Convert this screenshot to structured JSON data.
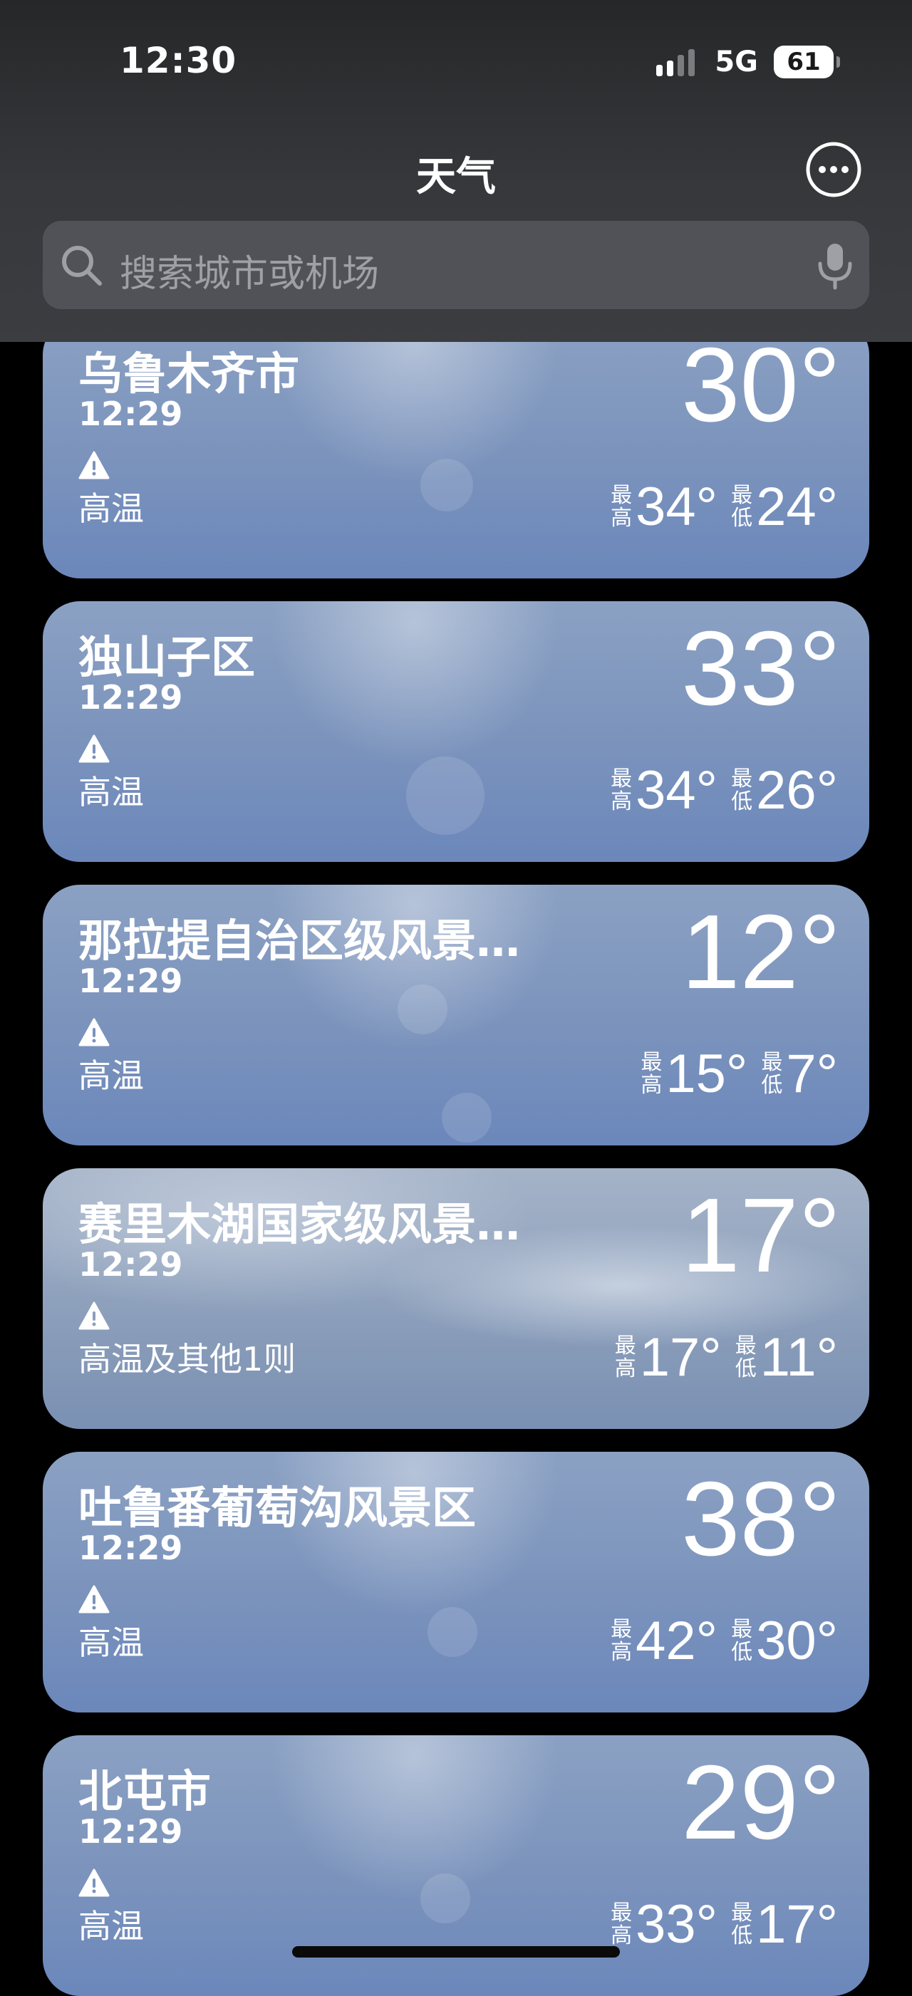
{
  "status_bar": {
    "time": "12:30",
    "network": "5G",
    "battery": "61",
    "signal_bars": 4,
    "signal_active": 2
  },
  "header": {
    "title": "天气",
    "more_icon": "ellipsis-circle-icon"
  },
  "search": {
    "placeholder": "搜索城市或机场",
    "search_icon": "magnifying-glass-icon",
    "mic_icon": "microphone-icon"
  },
  "cities": [
    {
      "name": "乌鲁木齐市",
      "time": "12:29",
      "temp": "30°",
      "alert": "高温",
      "high_label": "最高",
      "high": "34°",
      "low_label": "最低",
      "low": "24°",
      "condition": "clear"
    },
    {
      "name": "独山子区",
      "time": "12:29",
      "temp": "33°",
      "alert": "高温",
      "high_label": "最高",
      "high": "34°",
      "low_label": "最低",
      "low": "26°",
      "condition": "clear"
    },
    {
      "name": "那拉提自治区级风景…",
      "time": "12:29",
      "temp": "12°",
      "alert": "高温",
      "high_label": "最高",
      "high": "15°",
      "low_label": "最低",
      "low": "7°",
      "condition": "clear"
    },
    {
      "name": "赛里木湖国家级风景…",
      "time": "12:29",
      "temp": "17°",
      "alert": "高温及其他1则",
      "high_label": "最高",
      "high": "17°",
      "low_label": "最低",
      "low": "11°",
      "condition": "cloudy"
    },
    {
      "name": "吐鲁番葡萄沟风景区",
      "time": "12:29",
      "temp": "38°",
      "alert": "高温",
      "high_label": "最高",
      "high": "42°",
      "low_label": "最低",
      "low": "30°",
      "condition": "clear"
    },
    {
      "name": "北屯市",
      "time": "12:29",
      "temp": "29°",
      "alert": "高温",
      "high_label": "最高",
      "high": "33°",
      "low_label": "最低",
      "low": "17°",
      "condition": "clear"
    }
  ],
  "colors": {
    "header_bg": "#36383b",
    "search_bg": "#505257",
    "card_blue": "#7b93bc",
    "text": "#ffffff"
  }
}
